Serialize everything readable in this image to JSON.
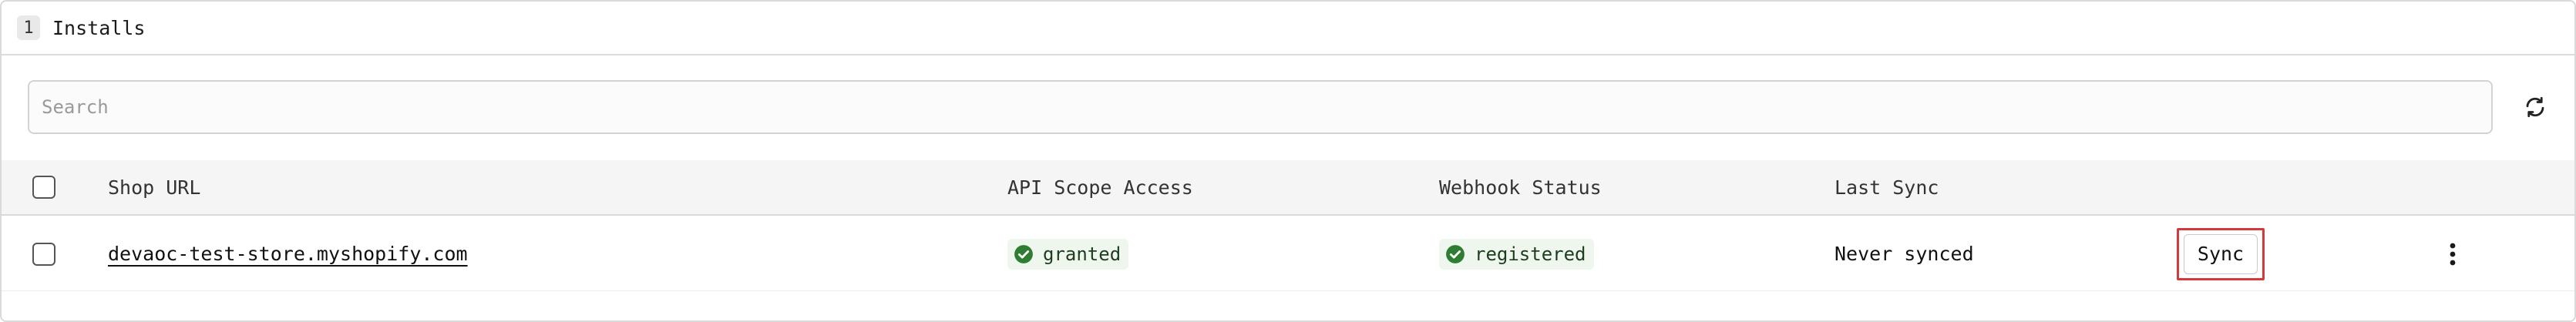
{
  "header": {
    "count": "1",
    "title": "Installs"
  },
  "search": {
    "placeholder": "Search",
    "value": ""
  },
  "toolbar": {
    "refresh_icon": "refresh-icon"
  },
  "table": {
    "columns": [
      "Shop URL",
      "API Scope Access",
      "Webhook Status",
      "Last Sync"
    ],
    "rows": [
      {
        "shop_url": "devaoc-test-store.myshopify.com",
        "api_scope_access": "granted",
        "webhook_status": "registered",
        "last_sync": "Never synced",
        "sync_label": "Sync",
        "more_icon": "more-vertical-icon"
      }
    ]
  },
  "colors": {
    "status_green": "#2e7d32",
    "status_bg": "#eef6ee",
    "highlight_red": "#d23b3b"
  }
}
